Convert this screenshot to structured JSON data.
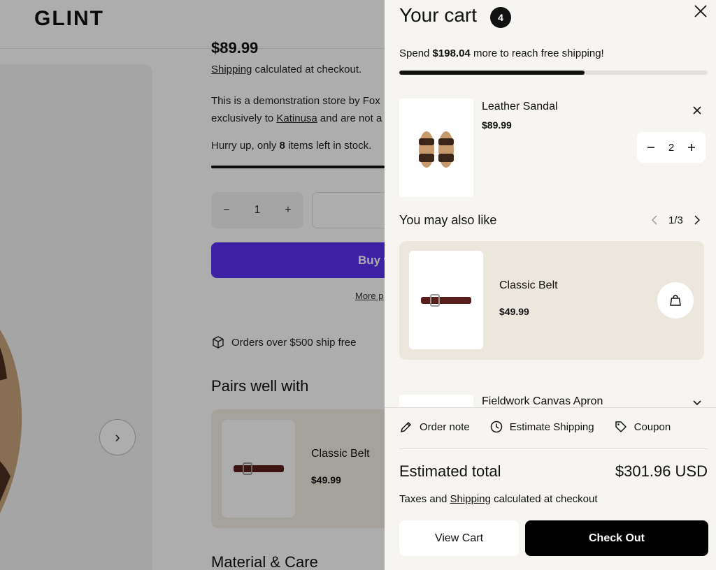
{
  "header": {
    "logo": "GLINT"
  },
  "product": {
    "price": "$89.99",
    "shipping_link": "Shipping",
    "shipping_suffix": " calculated at checkout.",
    "desc_line1": "This is a demonstration store by Fox",
    "desc_line2_prefix": "exclusively to ",
    "desc_link": "Katinusa",
    "desc_line2_suffix": " and are not a",
    "stock_prefix": "Hurry up, only ",
    "stock_count": "8",
    "stock_suffix": " items left in stock.",
    "quantity": "1",
    "buy_label": "Buy w",
    "more_label": "More p",
    "orders_text": "Orders over $500 ship free",
    "pairs_title": "Pairs well with",
    "pairs_item": {
      "name": "Classic Belt",
      "price": "$49.99"
    },
    "material_title": "Material & Care"
  },
  "cart": {
    "title": "Your cart",
    "count": "4",
    "spend_prefix": "Spend ",
    "spend_amount": "$198.04",
    "spend_suffix": " more to reach free shipping!",
    "shipping_progress": 0.6,
    "items": [
      {
        "name": "Leather Sandal",
        "price": "$89.99",
        "quantity": "2"
      },
      {
        "name": "Fieldwork Canvas Apron"
      }
    ],
    "recommend": {
      "title": "You may also like",
      "page": "1/3",
      "item": {
        "name": "Classic Belt",
        "price": "$49.99"
      }
    },
    "tools": {
      "note": "Order note",
      "shipping": "Estimate Shipping",
      "coupon": "Coupon"
    },
    "total_label": "Estimated total",
    "total_value": "$301.96 USD",
    "taxes_prefix": "Taxes and ",
    "taxes_link": "Shipping",
    "taxes_suffix": " calculated at checkout",
    "view_cart": "View Cart",
    "checkout": "Check Out"
  },
  "colors": {
    "buy_button": "#5a31f4",
    "drawer_bg": "#f7f5f1",
    "recommend_card_bg": "#ece7dc"
  }
}
